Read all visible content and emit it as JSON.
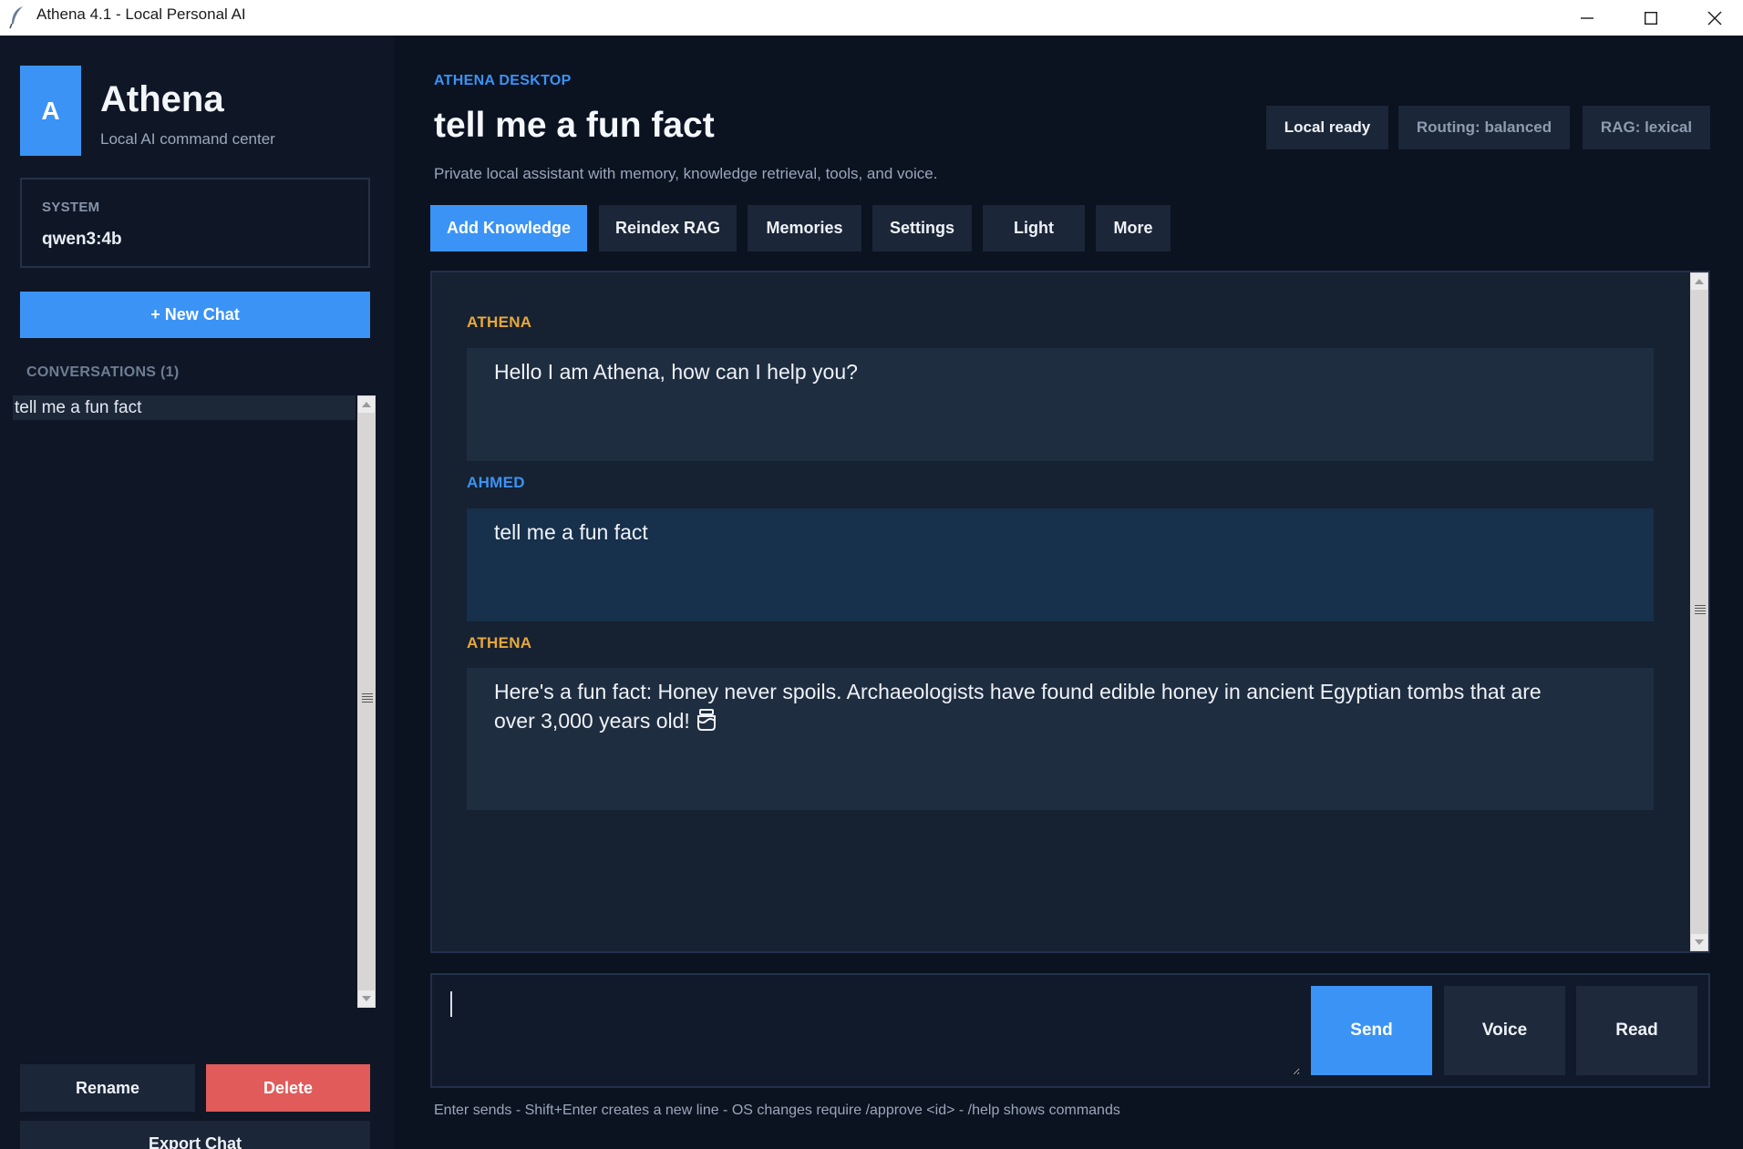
{
  "window": {
    "title": "Athena 4.1 - Local Personal AI",
    "icons": {
      "app": "feather-icon",
      "minimize": "minimize-icon",
      "maximize": "maximize-icon",
      "close": "close-icon"
    }
  },
  "sidebar": {
    "logo_letter": "A",
    "brand_name": "Athena",
    "brand_subtitle": "Local AI command center",
    "system_label": "SYSTEM",
    "system_model": "qwen3:4b",
    "new_chat_label": "+ New Chat",
    "conversations_header": "CONVERSATIONS (1)",
    "conversations": [
      {
        "title": "tell me a fun fact"
      }
    ],
    "rename_label": "Rename",
    "delete_label": "Delete",
    "export_label": "Export Chat"
  },
  "header": {
    "eyebrow": "ATHENA DESKTOP",
    "title": "tell me a fun fact",
    "subtitle": "Private local assistant with memory, knowledge retrieval, tools, and voice.",
    "status_pills": [
      "Local ready",
      "Routing: balanced",
      "RAG: lexical"
    ]
  },
  "toolbar": {
    "add_knowledge": "Add Knowledge",
    "reindex_rag": "Reindex RAG",
    "memories": "Memories",
    "settings": "Settings",
    "light": "Light",
    "more": "More"
  },
  "chat": {
    "messages": [
      {
        "author": "ATHENA",
        "role": "assistant",
        "text": "Hello I am Athena, how can I help you?"
      },
      {
        "author": "AHMED",
        "role": "user",
        "text": "tell me a fun fact"
      },
      {
        "author": "ATHENA",
        "role": "assistant",
        "text": "Here's a fun fact: Honey never spoils. Archaeologists have found edible honey in ancient Egyptian tombs that are",
        "text_line2": "over 3,000 years old!",
        "trailing_icon": "honey-pot-emoji-icon"
      }
    ]
  },
  "composer": {
    "value": "",
    "send_label": "Send",
    "voice_label": "Voice",
    "read_label": "Read",
    "hint": "Enter sends - Shift+Enter creates a new line - OS changes require /approve <id> - /help shows commands"
  },
  "colors": {
    "accent": "#3b93f5",
    "danger": "#e15b5b",
    "assistant_author": "#e8a83a",
    "background": "#0b1220"
  }
}
